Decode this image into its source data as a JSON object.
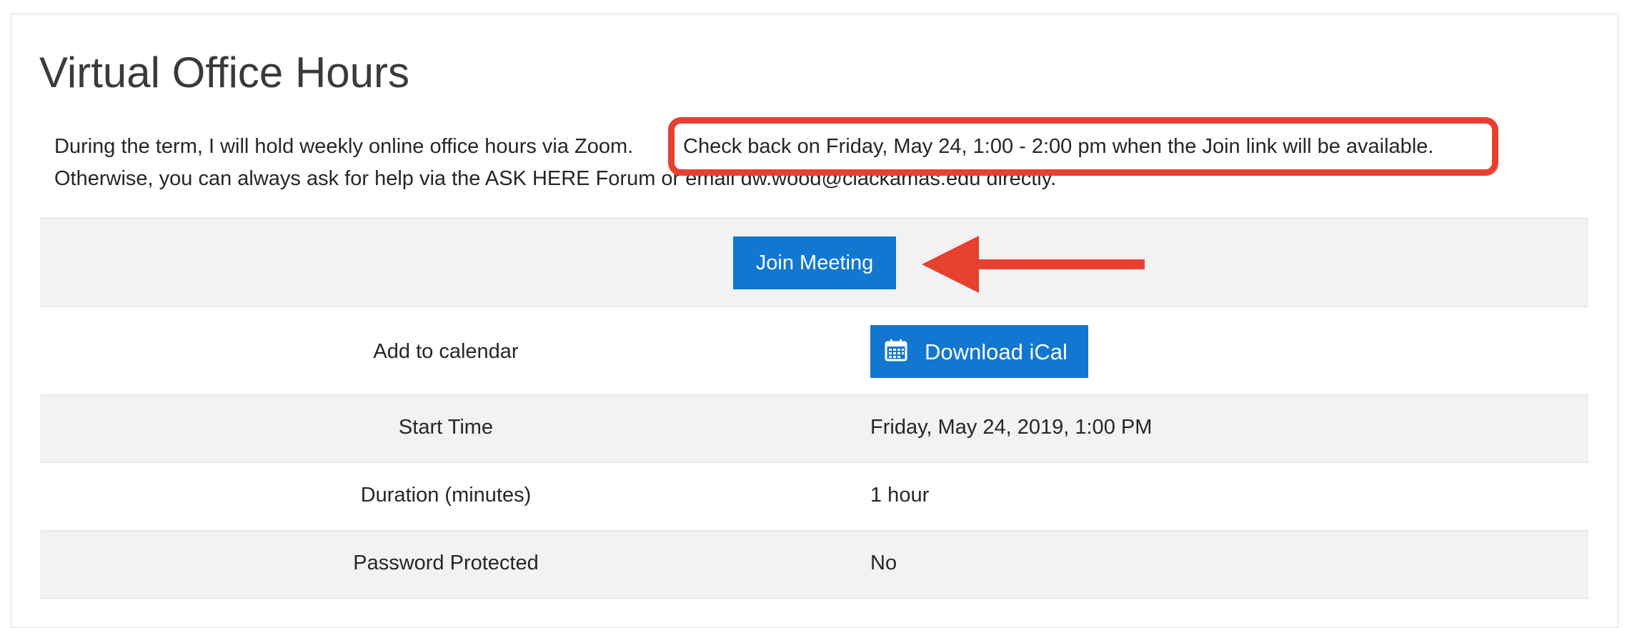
{
  "page": {
    "title": "Virtual Office Hours",
    "intro_line1_before": "During the term, I will hold weekly online office hours via Zoom.",
    "intro_callout": "Check back on Friday, May 24, 1:00 - 2:00 pm when the Join link will be available.",
    "intro_line2": "Otherwise, you can always ask for help via the ASK HERE Forum or email dw.wood@clackamas.edu directly."
  },
  "meeting": {
    "join_button_label": "Join Meeting",
    "calendar_label": "Add to calendar",
    "ical_button_label": "Download iCal",
    "ical_icon": "calendar-icon",
    "rows": [
      {
        "label": "Start Time",
        "value": "Friday, May 24, 2019, 1:00 PM"
      },
      {
        "label": "Duration (minutes)",
        "value": "1 hour"
      },
      {
        "label": "Password Protected",
        "value": "No"
      }
    ]
  },
  "annotations": {
    "highlight_color": "#e84030",
    "arrow_direction": "left"
  },
  "colors": {
    "button_bg": "#1177d1",
    "row_shade": "#f2f2f2"
  }
}
